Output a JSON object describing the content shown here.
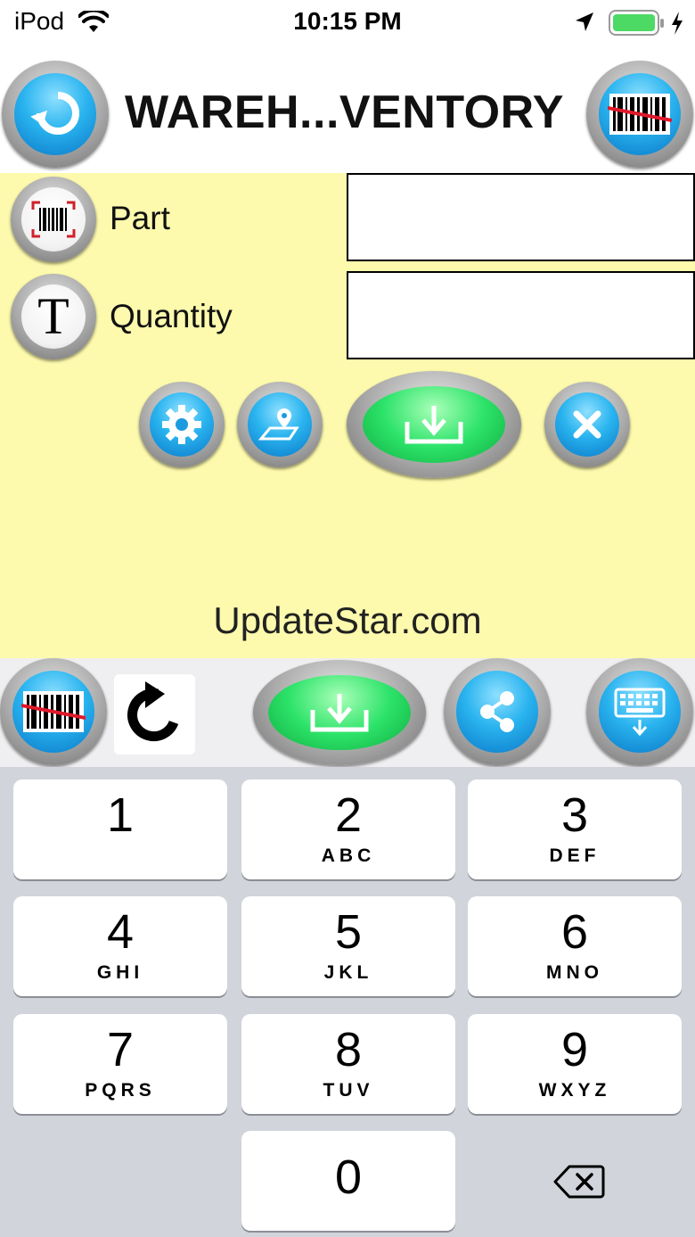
{
  "status_bar": {
    "carrier": "iPod",
    "time": "10:15 PM"
  },
  "header": {
    "title": "WAREH...VENTORY",
    "back_icon": "back-arrow-icon",
    "scan_icon": "barcode-scan-icon"
  },
  "form": {
    "part": {
      "label": "Part",
      "value": "",
      "icon": "barcode-icon"
    },
    "quantity": {
      "label": "Quantity",
      "value": "",
      "icon": "text-t-icon"
    },
    "actions": [
      "settings-gear-icon",
      "map-location-icon",
      "download-icon",
      "close-x-icon"
    ],
    "watermark": "UpdateStar.com"
  },
  "toolbar": {
    "items": [
      "barcode-scan-icon",
      "refresh-icon",
      "download-icon",
      "share-icon",
      "keyboard-hide-icon"
    ]
  },
  "keypad": {
    "keys": [
      {
        "num": "1",
        "letters": ""
      },
      {
        "num": "2",
        "letters": "ABC"
      },
      {
        "num": "3",
        "letters": "DEF"
      },
      {
        "num": "4",
        "letters": "GHI"
      },
      {
        "num": "5",
        "letters": "JKL"
      },
      {
        "num": "6",
        "letters": "MNO"
      },
      {
        "num": "7",
        "letters": "PQRS"
      },
      {
        "num": "8",
        "letters": "TUV"
      },
      {
        "num": "9",
        "letters": "WXYZ"
      },
      {
        "num": "0",
        "letters": ""
      }
    ]
  },
  "colors": {
    "form_background": "#fdfaad",
    "accent_blue": "#2ab4ef",
    "accent_green": "#2de36a",
    "keypad_background": "#d1d4da"
  }
}
